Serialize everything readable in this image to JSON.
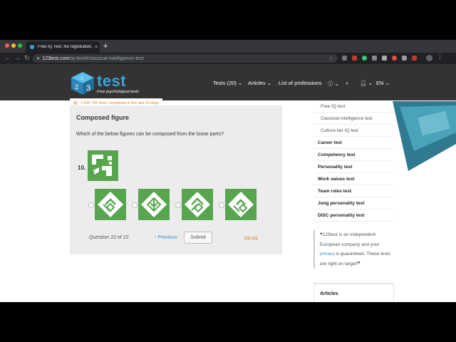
{
  "browser": {
    "tab_title": "Free IQ Test. No registration, ...",
    "tab_close": "×",
    "new_tab": "+",
    "url_host": "123test.com",
    "url_path": "/iq-test/#classical-intelligence-test",
    "lock_icon": "lock-icon",
    "colors": {
      "frame": "#35363a",
      "toolbar": "#202124"
    }
  },
  "site": {
    "logo_text": "test",
    "logo_digits": [
      "1",
      "2",
      "3"
    ],
    "tagline": "Free psychological tests",
    "nav": {
      "tests": "Tests (20)",
      "articles": "Articles",
      "professions": "List of professions",
      "language": "EN"
    },
    "counter": "1.420.790 tests completed in the last 30 days"
  },
  "test": {
    "title": "Composed figure",
    "question": "Which of the below figures can be composed from the loose parts?",
    "number": "10.",
    "progress": "Question 10 of 10",
    "previous": "- Previous",
    "submit": "Submit",
    "timer": "09:49",
    "answer_count": 4,
    "colors": {
      "figure_green": "#57a54f",
      "panel": "#ececec",
      "timer": "#e08a1e"
    }
  },
  "sidebar": {
    "items": [
      {
        "label": "Free IQ test",
        "level": "sub"
      },
      {
        "label": "Classical intelligence test",
        "level": "sub"
      },
      {
        "label": "Culture fair IQ test",
        "level": "sub"
      },
      {
        "label": "Career test",
        "level": "main"
      },
      {
        "label": "Competency test",
        "level": "main"
      },
      {
        "label": "Personality test",
        "level": "main"
      },
      {
        "label": "Work values test",
        "level": "main"
      },
      {
        "label": "Team roles test",
        "level": "main"
      },
      {
        "label": "Jung personality test",
        "level": "main"
      },
      {
        "label": "DISC personality test",
        "level": "main"
      }
    ],
    "quote_open": "❝",
    "quote_part1": "123test is an independent European company and your",
    "quote_link": "privacy",
    "quote_part2": "is guaranteed. These tests are right on target!",
    "quote_close": "❞",
    "articles_title": "Articles"
  }
}
